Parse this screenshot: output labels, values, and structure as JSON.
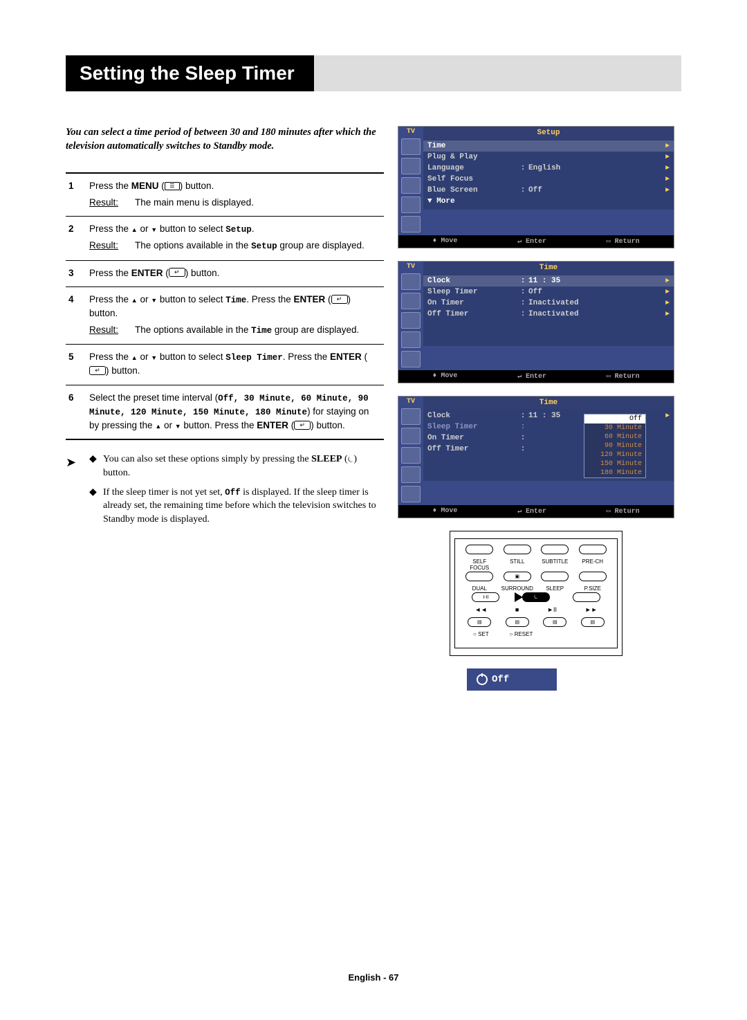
{
  "title": "Setting the Sleep Timer",
  "intro": "You can select a time period of between 30 and 180 minutes after which the television automatically switches to Standby mode.",
  "steps": {
    "s1": {
      "num": "1",
      "text_a": "Press the ",
      "menu": "MENU",
      "text_b": " button.",
      "result_label": "Result:",
      "result_text": "The main menu is displayed."
    },
    "s2": {
      "num": "2",
      "text_a": "Press the ",
      "text_b": " or ",
      "text_c": " button to select ",
      "setup": "Setup",
      "text_d": ".",
      "result_label": "Result:",
      "result_text_a": "The options available in the ",
      "result_text_b": " group are displayed."
    },
    "s3": {
      "num": "3",
      "text_a": "Press the ",
      "enter": "ENTER",
      "text_b": " button."
    },
    "s4": {
      "num": "4",
      "text_a": "Press the ",
      "text_b": " or ",
      "text_c": " button to select ",
      "time": "Time",
      "text_d": ". Press the ",
      "enter": "ENTER",
      "text_e": " button.",
      "result_label": "Result:",
      "result_text_a": "The options available in the ",
      "result_text_b": " group are displayed."
    },
    "s5": {
      "num": "5",
      "text_a": "Press the ",
      "text_b": " or ",
      "text_c": " button to select ",
      "sleep": "Sleep Timer",
      "text_d": ". Press the ",
      "enter": "ENTER",
      "text_e": " button."
    },
    "s6": {
      "num": "6",
      "text_a": "Select the preset time interval (",
      "opts": "Off, 30 Minute, 60 Minute, 90 Minute, 120 Minute, 150 Minute, 180 Minute",
      "text_b": ") for staying on by pressing the ",
      "text_c": " or ",
      "text_d": " button. Press the ",
      "enter": "ENTER",
      "text_e": " button."
    }
  },
  "notes": {
    "n1_a": "You can also set these options simply by pressing the ",
    "n1_sleep": "SLEEP",
    "n1_b": " button.",
    "n2_a": "If the sleep timer is not yet set, ",
    "n2_off": "Off",
    "n2_b": " is displayed. If the sleep timer is already set, the remaining time before which the television switches to Standby mode is displayed."
  },
  "osd1": {
    "tv": "TV",
    "title": "Setup",
    "r1": "Time",
    "r2": "Plug & Play",
    "r3_l": "Language",
    "r3_v": "English",
    "r4": "Self Focus",
    "r5_l": "Blue Screen",
    "r5_v": "Off",
    "r6": "More",
    "f_move": "Move",
    "f_enter": "Enter",
    "f_return": "Return"
  },
  "osd2": {
    "tv": "TV",
    "title": "Time",
    "r1_l": "Clock",
    "r1_v": "11 : 35",
    "r2_l": "Sleep Timer",
    "r2_v": "Off",
    "r3_l": "On Timer",
    "r3_v": "Inactivated",
    "r4_l": "Off Timer",
    "r4_v": "Inactivated",
    "f_move": "Move",
    "f_enter": "Enter",
    "f_return": "Return"
  },
  "osd3": {
    "tv": "TV",
    "title": "Time",
    "r1_l": "Clock",
    "r1_v": "11 : 35",
    "r2_l": "Sleep Timer",
    "r3_l": "On Timer",
    "r4_l": "Off Timer",
    "dd": [
      "Off",
      "30 Minute",
      "60 Minute",
      "90 Minute",
      "120 Minute",
      "150 Minute",
      "180 Minute"
    ],
    "f_move": "Move",
    "f_enter": "Enter",
    "f_return": "Return"
  },
  "remote": {
    "r1": [
      "SELF FOCUS",
      "STILL",
      "SUBTITLE",
      "PRE-CH"
    ],
    "r2": [
      "DUAL",
      "SURROUND",
      "SLEEP",
      "P.SIZE"
    ],
    "dual": "I-II",
    "play": [
      "◄◄",
      "■",
      "►II",
      "►►"
    ],
    "bottom": [
      "SET",
      "RESET"
    ]
  },
  "off_indicator": "Off",
  "footer": "English - 67"
}
